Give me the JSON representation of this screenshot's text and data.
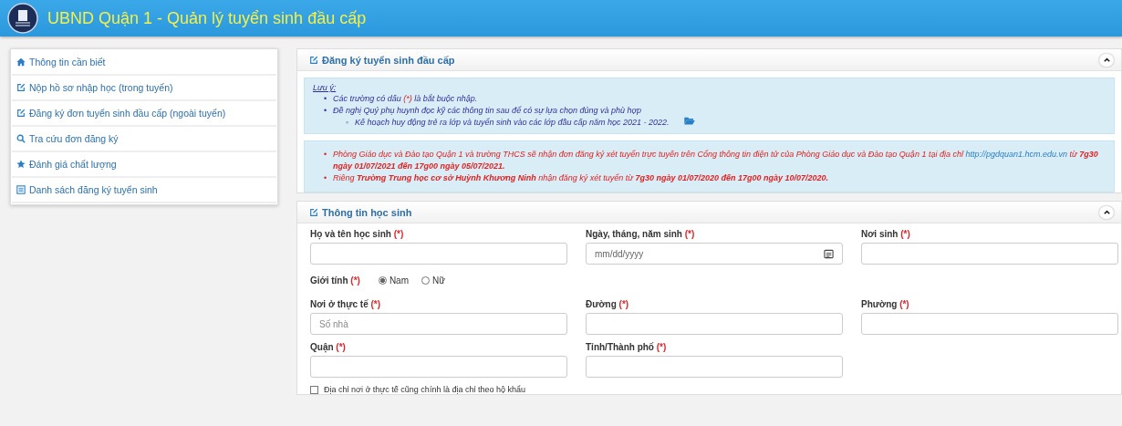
{
  "header": {
    "title": "UBND Quận 1 - Quản lý tuyển sinh đầu cấp"
  },
  "sidebar": {
    "items": [
      {
        "label": "Thông tin cần biết"
      },
      {
        "label": "Nộp hồ sơ nhập học (trong tuyến)"
      },
      {
        "label": "Đăng ký đơn tuyển sinh đầu cấp (ngoài tuyến)"
      },
      {
        "label": "Tra cứu đơn đăng ký"
      },
      {
        "label": "Đánh giá chất lượng"
      },
      {
        "label": "Danh sách đăng ký tuyển sinh"
      }
    ]
  },
  "registration_panel": {
    "title": "Đăng ký tuyển sinh đầu cấp",
    "expanded": true,
    "note": {
      "title": "Lưu ý:",
      "items": [
        {
          "marker": "•",
          "parts": [
            {
              "kind": "text",
              "text": "Các trường có dấu "
            },
            {
              "kind": "required",
              "text": "(*)"
            },
            {
              "kind": "text",
              "text": " là bắt buộc nhập."
            }
          ]
        },
        {
          "marker": "•",
          "parts": [
            {
              "kind": "text",
              "text": "Đề nghị Quý phụ huynh đọc kỹ các thông tin sau để có sự lựa chọn đúng và phù hợp"
            }
          ],
          "children": [
            {
              "marker": "◦",
              "parts": [
                {
                  "kind": "text",
                  "text": "Kế hoạch huy động trẻ ra lớp và tuyển sinh vào các lớp đầu cấp năm học 2021 - 2022."
                }
              ],
              "attachment": true
            }
          ]
        }
      ]
    },
    "notices": [
      {
        "marker": "•",
        "parts": [
          {
            "kind": "text",
            "text": "Phòng Giáo dục và Đào tạo Quận 1 và trường THCS sẽ nhận đơn đăng ký xét tuyển trực tuyến trên Cổng thông tin điện tử của Phòng Giáo dục và Đào tạo Quận 1 tại địa chỉ "
          },
          {
            "kind": "link",
            "text": "http://pgdquan1.hcm.edu.vn"
          },
          {
            "kind": "text",
            "text": " từ **7g30 ngày 01/07/2021 đến 17g00 ngày 05/07/2021.**"
          }
        ]
      },
      {
        "marker": "•",
        "parts": [
          {
            "kind": "text",
            "text": "Riêng **Trường Trung học cơ sở Huỳnh Khương Ninh** nhận đăng ký xét tuyển từ **7g30 ngày 01/07/2020 đến 17g00 ngày 10/07/2020.**"
          }
        ]
      }
    ]
  },
  "student_panel": {
    "title": "Thông tin học sinh",
    "expanded": true,
    "rows": [
      {
        "fields": [
          {
            "kind": "text",
            "label": "Họ và tên học sinh",
            "required": "(*)"
          },
          {
            "kind": "date",
            "label": "Ngày, tháng, năm sinh",
            "required": "(*)",
            "placeholder": "mm/dd/yyyy"
          },
          {
            "kind": "text",
            "label": "Nơi sinh",
            "required": "(*)"
          }
        ]
      },
      {
        "fields": [
          {
            "kind": "radio",
            "label": "Giới tính",
            "required": "(*)",
            "options": [
              {
                "label": "Nam",
                "selected": true
              },
              {
                "label": "Nữ",
                "selected": false
              }
            ]
          }
        ]
      },
      {
        "fields": [
          {
            "kind": "text",
            "label": "Nơi ở thực tế",
            "required": "(*)",
            "placeholder": "Số nhà"
          },
          {
            "kind": "text",
            "label": "Đường",
            "required": "(*)"
          },
          {
            "kind": "text",
            "label": "Phường",
            "required": "(*)"
          }
        ]
      },
      {
        "fields": [
          {
            "kind": "text",
            "label": "Quận",
            "required": "(*)"
          },
          {
            "kind": "text",
            "label": "Tỉnh/Thành phố",
            "required": "(*)"
          }
        ]
      }
    ],
    "same_address": {
      "label": "Địa chỉ nơi ở thực tế cũng chính là địa chỉ theo hộ khẩu",
      "checked": false
    }
  }
}
